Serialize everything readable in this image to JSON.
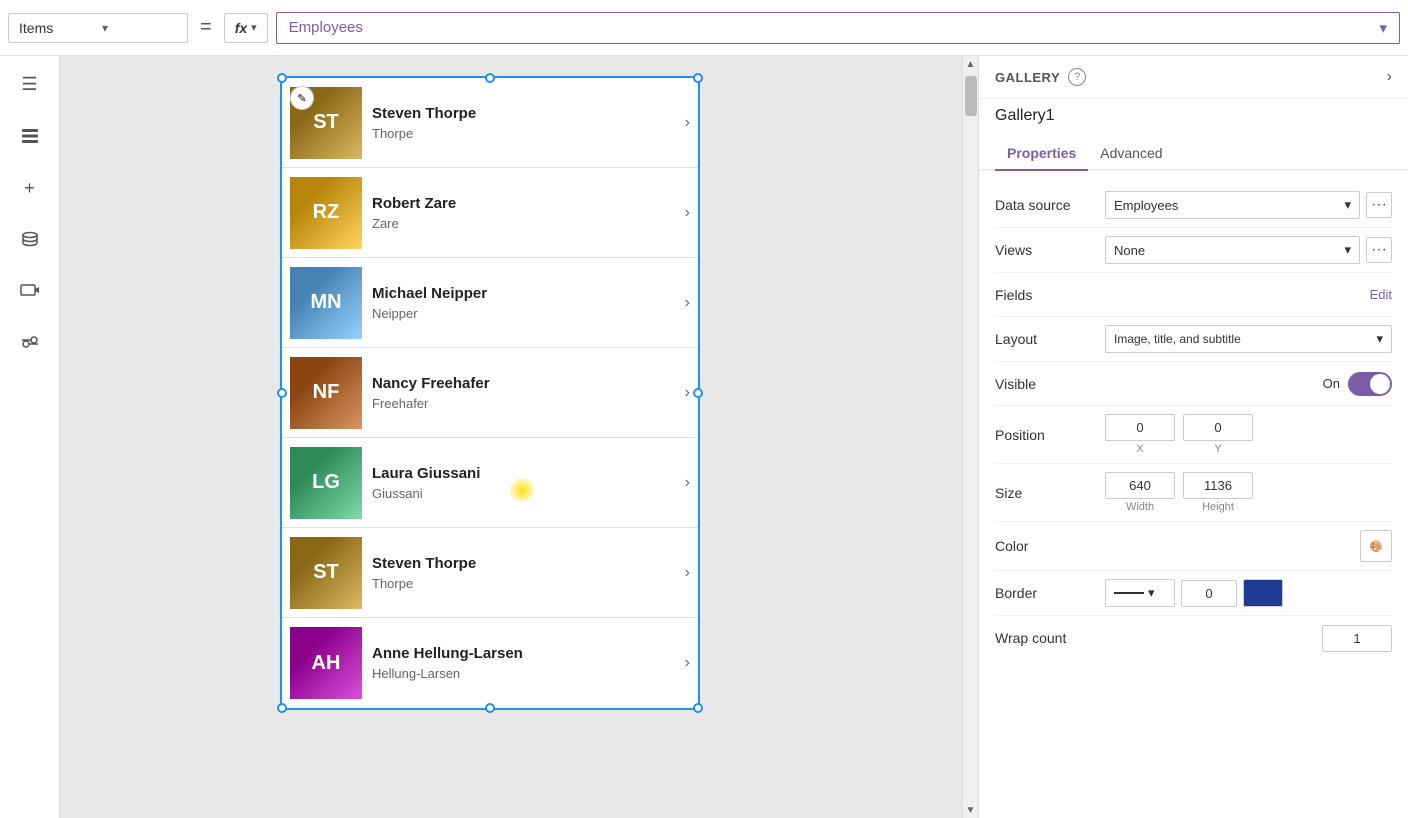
{
  "topbar": {
    "items_label": "Items",
    "items_chevron": "▾",
    "equals": "=",
    "fx_label": "fx",
    "fx_chevron": "▾",
    "formula_value": "Employees",
    "formula_chevron": "▾"
  },
  "sidebar": {
    "icons": [
      {
        "name": "hamburger-icon",
        "symbol": "☰"
      },
      {
        "name": "layers-icon",
        "symbol": "⊞"
      },
      {
        "name": "add-icon",
        "symbol": "+"
      },
      {
        "name": "database-icon",
        "symbol": "🗄"
      },
      {
        "name": "media-icon",
        "symbol": "▶"
      },
      {
        "name": "tools-icon",
        "symbol": "🔧"
      }
    ]
  },
  "gallery": {
    "items": [
      {
        "name": "Steven Thorpe",
        "subtitle": "Thorpe",
        "photo_color": "#8B6914",
        "initials": "ST"
      },
      {
        "name": "Robert Zare",
        "subtitle": "Zare",
        "photo_color": "#b8860b",
        "initials": "RZ"
      },
      {
        "name": "Michael Neipper",
        "subtitle": "Neipper",
        "photo_color": "#4682B4",
        "initials": "MN"
      },
      {
        "name": "Nancy Freehafer",
        "subtitle": "Freehafer",
        "photo_color": "#8B4513",
        "initials": "NF"
      },
      {
        "name": "Laura Giussani",
        "subtitle": "Giussani",
        "photo_color": "#2E8B57",
        "initials": "LG"
      },
      {
        "name": "Steven Thorpe",
        "subtitle": "Thorpe",
        "photo_color": "#8B6914",
        "initials": "ST"
      },
      {
        "name": "Anne Hellung-Larsen",
        "subtitle": "Hellung-Larsen",
        "photo_color": "#8B008B",
        "initials": "AH"
      }
    ],
    "chevron": "›"
  },
  "panel": {
    "gallery_label": "GALLERY",
    "component_name": "Gallery1",
    "tabs": [
      {
        "label": "Properties",
        "active": true
      },
      {
        "label": "Advanced",
        "active": false
      }
    ],
    "properties": {
      "data_source_label": "Data source",
      "data_source_value": "Employees",
      "views_label": "Views",
      "views_value": "None",
      "fields_label": "Fields",
      "fields_edit": "Edit",
      "layout_label": "Layout",
      "layout_value": "Image, title, and subtitle",
      "visible_label": "Visible",
      "visible_on": "On",
      "position_label": "Position",
      "pos_x": "0",
      "pos_y": "0",
      "pos_x_label": "X",
      "pos_y_label": "Y",
      "size_label": "Size",
      "size_w": "640",
      "size_h": "1136",
      "size_w_label": "Width",
      "size_h_label": "Height",
      "color_label": "Color",
      "border_label": "Border",
      "border_width": "0",
      "wrap_count_label": "Wrap count",
      "wrap_count_value": "1"
    }
  }
}
